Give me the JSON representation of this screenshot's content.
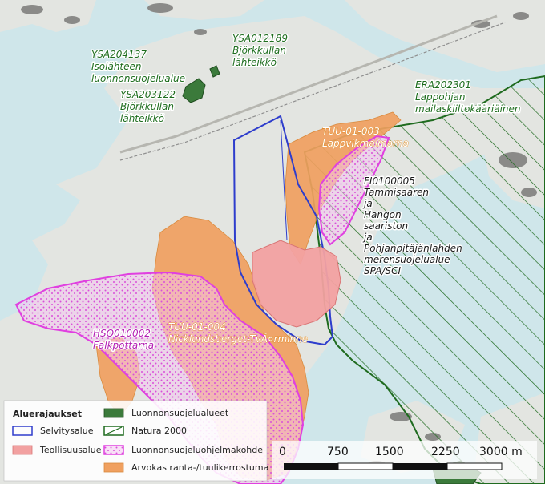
{
  "map": {
    "labels": {
      "ysa204137": {
        "code": "YSA204137",
        "l1": "Isolähteen",
        "l2": "luonnonsuojelualue"
      },
      "ysa012189": {
        "code": "YSA012189",
        "l1": "Björkkullan",
        "l2": "lähteikkö"
      },
      "ysa203122": {
        "code": "YSA203122",
        "l1": "Björkkullan",
        "l2": "lähteikkö"
      },
      "era202301": {
        "code": "ERA202301",
        "l1": "Lappohjan",
        "l2": "mailaskiiltokääriäinen"
      },
      "tuu01003": {
        "code": "TUU-01-003",
        "l1": "Lappvikmalmarna"
      },
      "fi0100005": {
        "lines": [
          "FI0100005",
          "Tammisaaren",
          "ja",
          "Hangon",
          "saariston",
          "ja",
          "Pohjanpitäjänlahden",
          "merensuojelualue",
          "SPA/SCI"
        ]
      },
      "hso010002": {
        "code": "HSO010002",
        "l1": "Falkpottarna"
      },
      "tuu01004": {
        "code": "TUU-01-004",
        "l1": "Nicklundsberget-TvÃ¤rminne"
      }
    },
    "colors": {
      "water": "#cfe6ea",
      "land": "#e3e5e1",
      "selvitysalue": "#2e3dcc",
      "teollisuusalue": "#f2a1a1",
      "natura": "#1f6b1f",
      "luonnonsuojelualue": "#3b7a3b",
      "ohjelmakohde": "#e040e0",
      "ranta": "#f0a060"
    }
  },
  "legend": {
    "title": "Aluerajaukset",
    "items": [
      {
        "label": "Selvitysalue",
        "icon": "blue-outline-swatch"
      },
      {
        "label": "Teollisuusalue",
        "icon": "pink-fill-swatch"
      },
      {
        "label": "Luonnonsuojelualueet",
        "icon": "green-fill-swatch"
      },
      {
        "label": "Natura 2000",
        "icon": "hatched-green-swatch"
      },
      {
        "label": "Luonnonsuojeluohjelmakohde",
        "icon": "dotted-magenta-swatch"
      },
      {
        "label": "Arvokas ranta-/tuulikerrostuma",
        "icon": "orange-fill-swatch"
      }
    ]
  },
  "scalebar": {
    "ticks": [
      "0",
      "750",
      "1500",
      "2250",
      "3000 m"
    ]
  }
}
